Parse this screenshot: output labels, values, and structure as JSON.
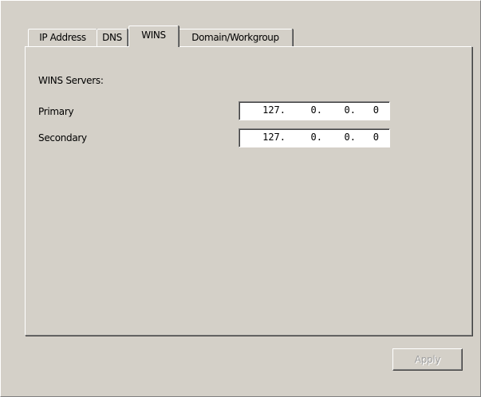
{
  "tabs": [
    {
      "label": "IP Address",
      "active": false
    },
    {
      "label": "DNS",
      "active": false
    },
    {
      "label": "WINS",
      "active": true
    },
    {
      "label": "Domain/Workgroup",
      "active": false
    }
  ],
  "wins": {
    "section_label": "WINS Servers:",
    "primary": {
      "label": "Primary",
      "octets": [
        "127",
        "0",
        "0",
        "0"
      ]
    },
    "secondary": {
      "label": "Secondary",
      "octets": [
        "127",
        "0",
        "0",
        "0"
      ]
    }
  },
  "buttons": {
    "apply": {
      "label": "Apply",
      "enabled": false
    }
  },
  "colors": {
    "face": "#d4d0c8",
    "highlight": "#ffffff",
    "shadow": "#808080",
    "dark_shadow": "#404040",
    "disabled_text": "#a0a0a0"
  }
}
